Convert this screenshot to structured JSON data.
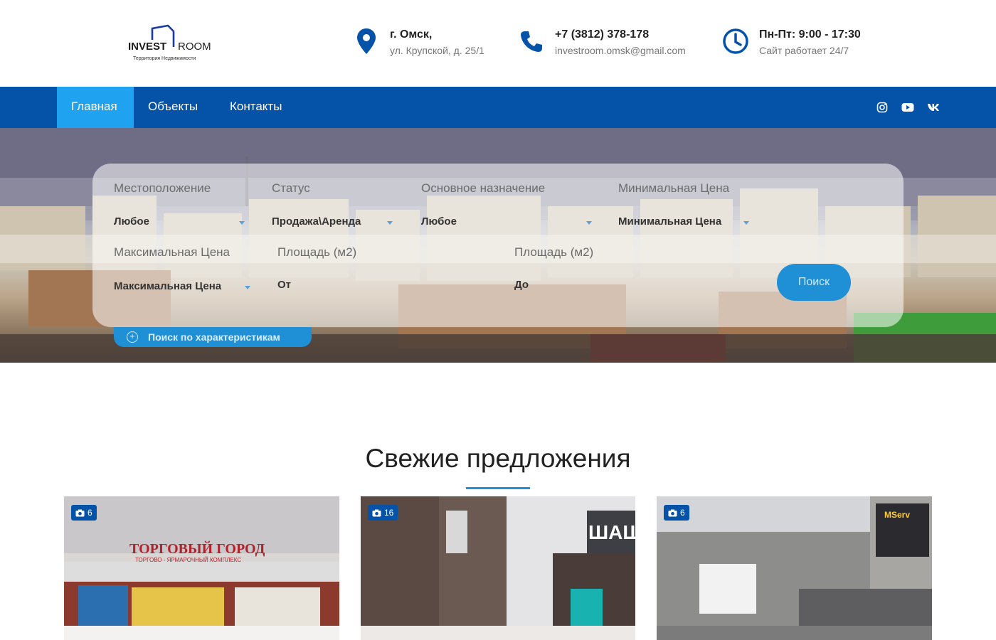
{
  "header": {
    "logo": {
      "brand_left": "INVEST",
      "brand_right": "ROOM",
      "tagline": "Территория Недвижимости"
    },
    "location": {
      "city": "г. Омск,",
      "address": "ул. Крупской, д. 25/1",
      "icon": "map-pin-icon"
    },
    "contact": {
      "phone": "+7 (3812) 378-178",
      "email": "investroom.omsk@gmail.com",
      "icon": "phone-icon"
    },
    "hours": {
      "schedule": "Пн-Пт: 9:00 - 17:30",
      "note": "Сайт работает 24/7",
      "icon": "clock-icon"
    }
  },
  "nav": {
    "items": [
      {
        "label": "Главная",
        "active": true
      },
      {
        "label": "Объекты",
        "active": false
      },
      {
        "label": "Контакты",
        "active": false
      }
    ],
    "social": [
      "instagram-icon",
      "youtube-icon",
      "vk-icon"
    ]
  },
  "search": {
    "fields": {
      "location": {
        "label": "Местоположение",
        "value": "Любое"
      },
      "status": {
        "label": "Статус",
        "value": "Продажа\\Аренда"
      },
      "purpose": {
        "label": "Основное назначение",
        "value": "Любое"
      },
      "min_price": {
        "label": "Минимальная Цена",
        "value": "Минимальная Цена"
      },
      "max_price": {
        "label": "Максимальная Цена",
        "value": "Максимальная Цена"
      },
      "area_from": {
        "label": "Площадь (м2)",
        "value": "От"
      },
      "area_to": {
        "label": "Площадь (м2)",
        "value": "До"
      }
    },
    "submit_label": "Поиск",
    "advanced_label": "Поиск по характеристикам"
  },
  "fresh": {
    "title": "Свежие предложения",
    "cards": [
      {
        "photo_count": "6",
        "sign_line1": "ТОРГОВЫЙ ГОРОД",
        "sign_line2": "ТОРГОВО - ЯРМАРОЧНЫЙ КОМПЛЕКС"
      },
      {
        "photo_count": "16",
        "sign_text": "ШАШ"
      },
      {
        "photo_count": "6",
        "sign_text": "MServ"
      }
    ]
  },
  "colors": {
    "primary": "#0553a8",
    "accent": "#1fa2ef",
    "button": "#1f8fd6"
  }
}
